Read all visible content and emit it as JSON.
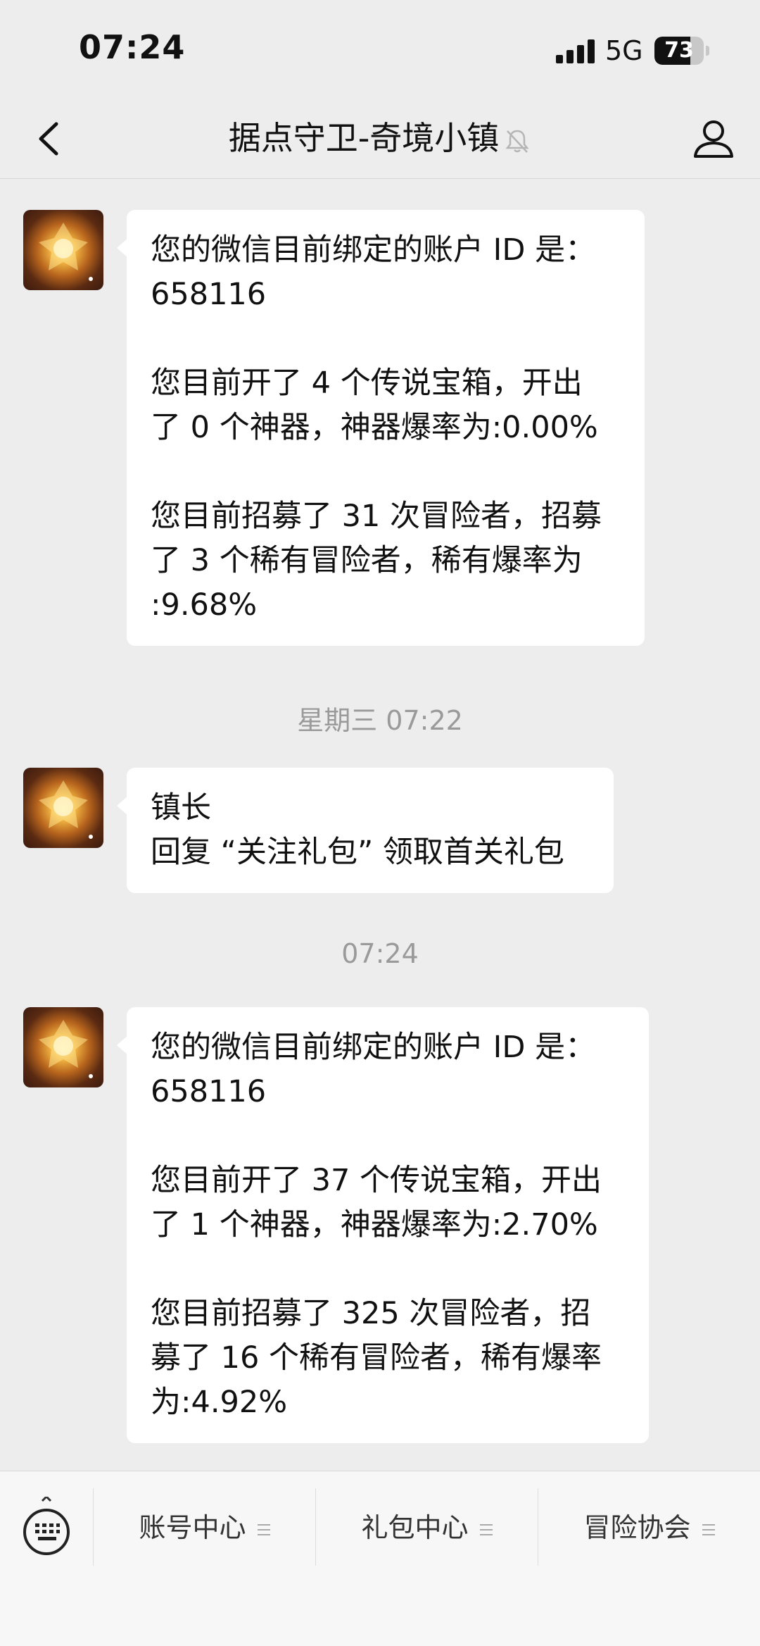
{
  "status_bar": {
    "time": "07:24",
    "network": "5G",
    "battery_level": "73",
    "battery_percent": 73
  },
  "nav": {
    "title": "据点守卫-奇境小镇",
    "muted": true
  },
  "messages": [
    {
      "sender_avatar": "game-emblem-avatar",
      "paragraphs": [
        [
          "您的微信目前绑定的账户 ID 是：",
          "658116"
        ],
        [
          "您目前开了 4 个传说宝箱，开出",
          "了 0 个神器，神器爆率为:0.00%"
        ],
        [
          "您目前招募了 31 次冒险者，招募",
          "了 3 个稀有冒险者，稀有爆率为",
          ":9.68%"
        ]
      ]
    },
    {
      "sender_avatar": "game-emblem-avatar",
      "paragraphs": [
        [
          "镇长",
          "回复 “关注礼包” 领取首关礼包"
        ]
      ]
    },
    {
      "sender_avatar": "game-emblem-avatar",
      "paragraphs": [
        [
          "您的微信目前绑定的账户 ID 是：",
          "658116"
        ],
        [
          "您目前开了 37 个传说宝箱，开出",
          "了 1 个神器，神器爆率为:2.70%"
        ],
        [
          "您目前招募了 325 次冒险者，招",
          "募了 16 个稀有冒险者，稀有爆率",
          "为:4.92%"
        ]
      ]
    }
  ],
  "timestamps": [
    "星期三 07:22",
    "07:24"
  ],
  "bottom_menu": {
    "items": [
      "账号中心",
      "礼包中心",
      "冒险协会"
    ]
  },
  "colors": {
    "background": "#ededed",
    "bubble": "#ffffff",
    "timestamp_text": "#9a9a9a",
    "menu_bg": "#f7f7f7"
  }
}
